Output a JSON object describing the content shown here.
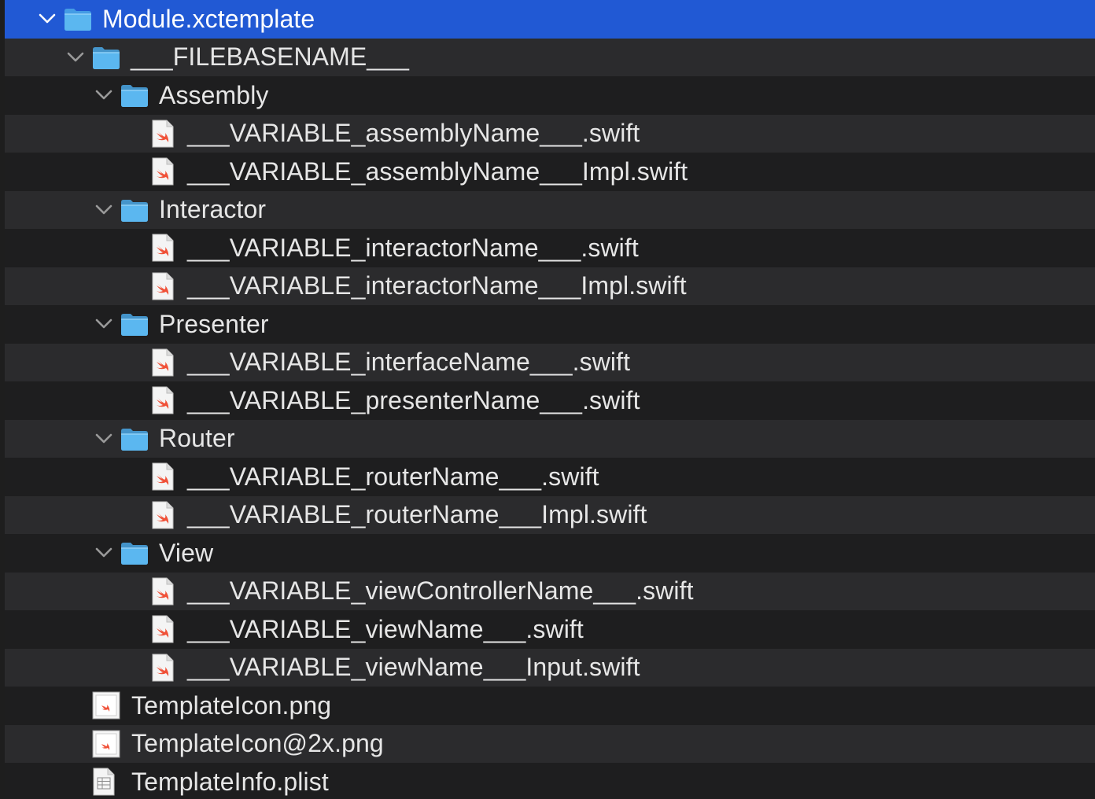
{
  "tree": {
    "rows": [
      {
        "label": "Module.xctemplate",
        "kind": "folder",
        "level": 0,
        "expanded": true,
        "selected": true
      },
      {
        "label": "___FILEBASENAME___",
        "kind": "folder",
        "level": 1,
        "expanded": true
      },
      {
        "label": "Assembly",
        "kind": "folder",
        "level": 2,
        "expanded": true
      },
      {
        "label": "___VARIABLE_assemblyName___.swift",
        "kind": "swift",
        "level": 3
      },
      {
        "label": "___VARIABLE_assemblyName___Impl.swift",
        "kind": "swift",
        "level": 3
      },
      {
        "label": "Interactor",
        "kind": "folder",
        "level": 2,
        "expanded": true
      },
      {
        "label": "___VARIABLE_interactorName___.swift",
        "kind": "swift",
        "level": 3
      },
      {
        "label": "___VARIABLE_interactorName___Impl.swift",
        "kind": "swift",
        "level": 3
      },
      {
        "label": "Presenter",
        "kind": "folder",
        "level": 2,
        "expanded": true
      },
      {
        "label": "___VARIABLE_interfaceName___.swift",
        "kind": "swift",
        "level": 3
      },
      {
        "label": "___VARIABLE_presenterName___.swift",
        "kind": "swift",
        "level": 3
      },
      {
        "label": "Router",
        "kind": "folder",
        "level": 2,
        "expanded": true
      },
      {
        "label": "___VARIABLE_routerName___.swift",
        "kind": "swift",
        "level": 3
      },
      {
        "label": "___VARIABLE_routerName___Impl.swift",
        "kind": "swift",
        "level": 3
      },
      {
        "label": "View",
        "kind": "folder",
        "level": 2,
        "expanded": true
      },
      {
        "label": "___VARIABLE_viewControllerName___.swift",
        "kind": "swift",
        "level": 3
      },
      {
        "label": "___VARIABLE_viewName___.swift",
        "kind": "swift",
        "level": 3
      },
      {
        "label": "___VARIABLE_viewName___Input.swift",
        "kind": "swift",
        "level": 3
      },
      {
        "label": "TemplateIcon.png",
        "kind": "png",
        "level": 1
      },
      {
        "label": "TemplateIcon@2x.png",
        "kind": "png",
        "level": 1
      },
      {
        "label": "TemplateInfo.plist",
        "kind": "plist",
        "level": 1
      }
    ]
  },
  "colors": {
    "selection": "#2159d4",
    "folder": "#4aa8e8",
    "swift": "#f05138"
  }
}
